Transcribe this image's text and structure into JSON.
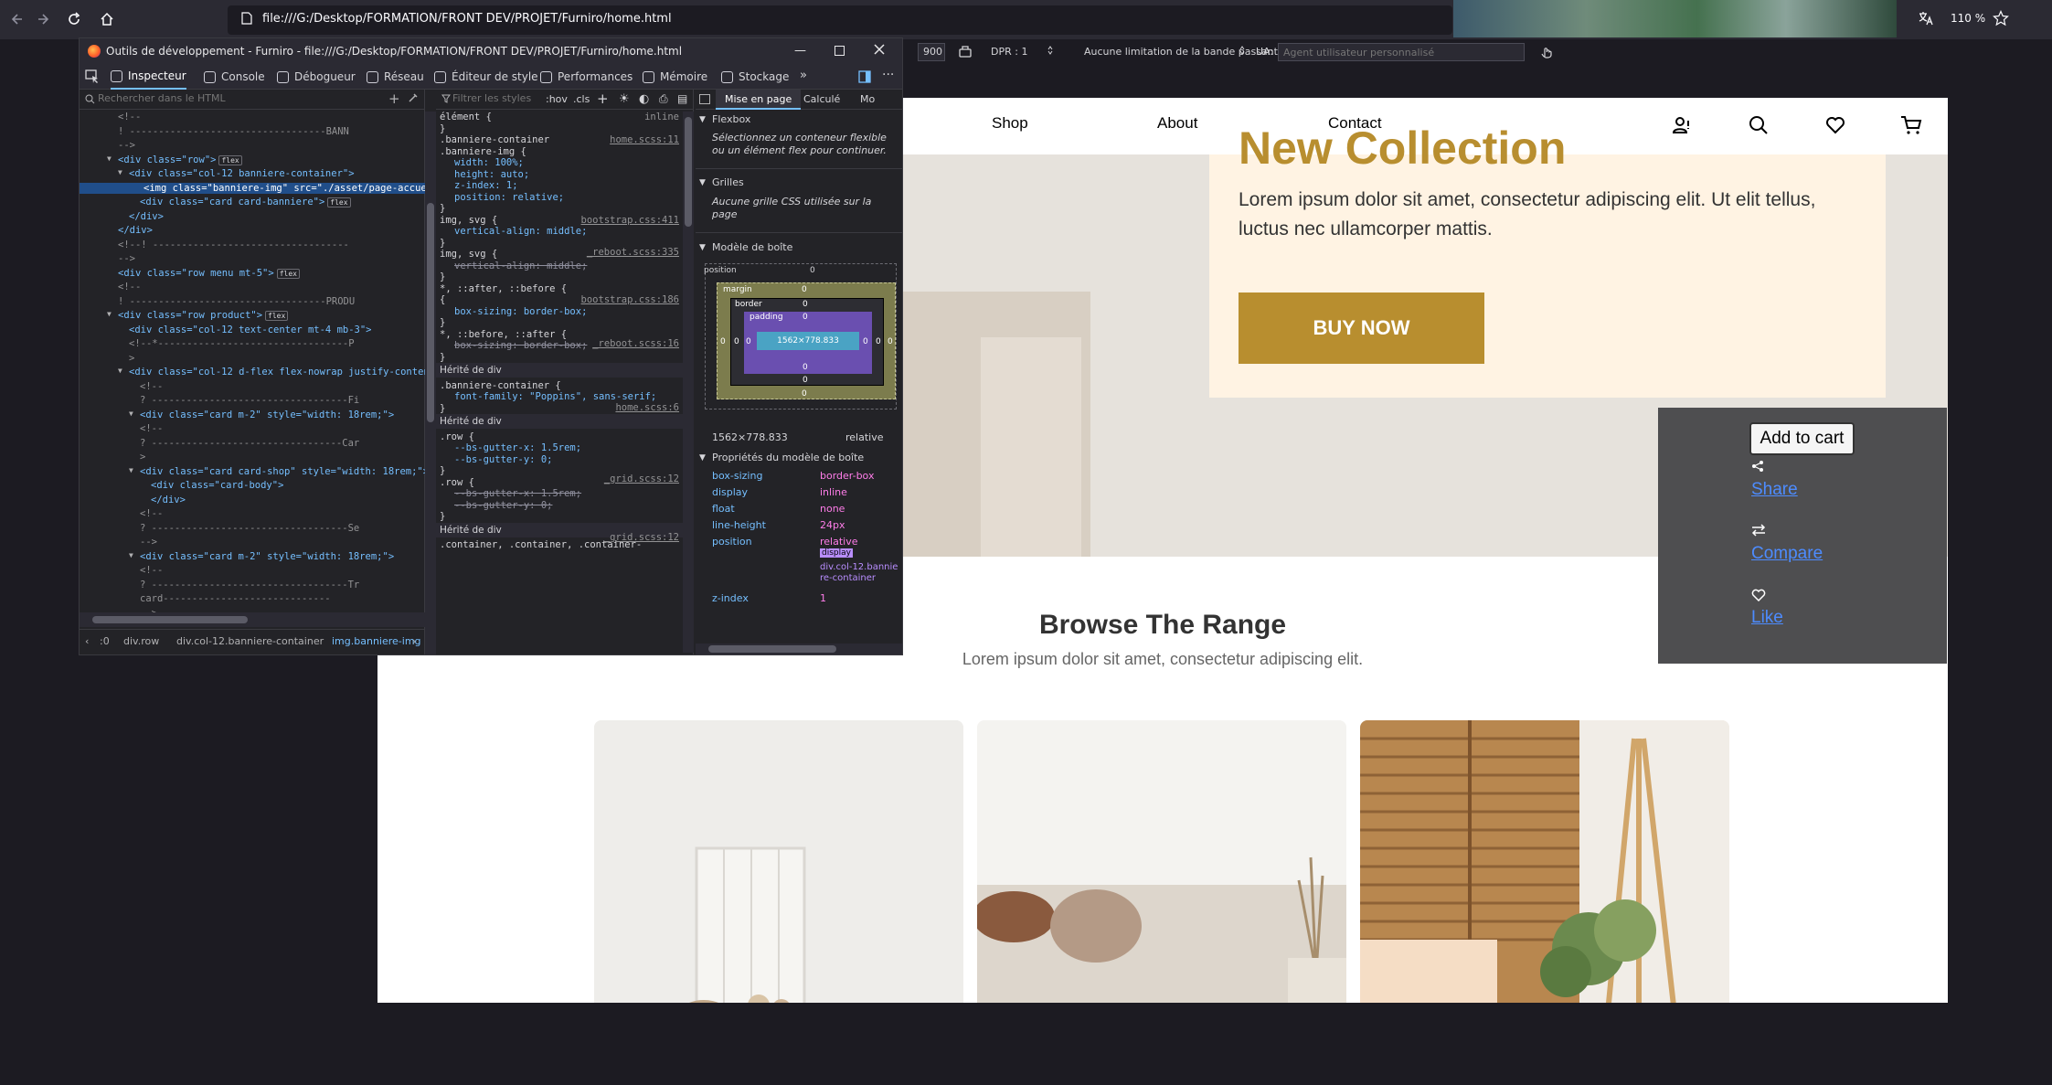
{
  "browser": {
    "url": "file:///G:/Desktop/FORMATION/FRONT DEV/PROJET/Furniro/home.html",
    "zoom": "110 %"
  },
  "responsive": {
    "height_value": "900",
    "dpr": "DPR : 1",
    "throttle": "Aucune limitation de la bande passante",
    "ua_label": "UA:",
    "ua_placeholder": "Agent utilisateur personnalisé"
  },
  "devtools": {
    "title": "Outils de développement - Furniro - file:///G:/Desktop/FORMATION/FRONT DEV/PROJET/Furniro/home.html",
    "tabs": [
      "Inspecteur",
      "Console",
      "Débogueur",
      "Réseau",
      "Éditeur de style",
      "Performances",
      "Mémoire",
      "Stockage"
    ],
    "search_placeholder": "Rechercher dans le HTML",
    "filter_placeholder": "Filtrer les styles",
    "hov": ":hov",
    "cls": ".cls",
    "layout_tabs": [
      "Mise en page",
      "Calculé",
      "Mo"
    ],
    "flexbox_title": "Flexbox",
    "flexbox_text": "Sélectionnez un conteneur flexible ou un élément flex pour continuer.",
    "grid_title": "Grilles",
    "grid_text": "Aucune grille CSS utilisée sur la page",
    "box_title": "Modèle de boîte",
    "box": {
      "position": "position",
      "margin": "margin",
      "border": "border",
      "padding": "padding",
      "content": "1562×778.833",
      "zero": "0"
    },
    "box_dims": "1562×778.833",
    "box_pos": "relative",
    "props_title": "Propriétés du modèle de boîte",
    "props": [
      {
        "k": "box-sizing",
        "v": "border-box"
      },
      {
        "k": "display",
        "v": "inline"
      },
      {
        "k": "float",
        "v": "none"
      },
      {
        "k": "line-height",
        "v": "24px"
      },
      {
        "k": "position",
        "v": "relative"
      }
    ],
    "offset_parent_badge": "display",
    "offset_parent_text": "div.col-12.banniere-container",
    "zindex_k": "z-index",
    "zindex_v": "1",
    "breadcrumb": [
      ":0",
      "div.row",
      "div.col-12.banniere-container",
      "img.banniere-img"
    ],
    "html_lines": [
      "<!--",
      "! ----------------------------------BANN",
      "-->",
      "<div class=\"row\">",
      "<div class=\"col-12 banniere-container\">",
      "<img class=\"banniere-img\" src=\"./asset/page-accuei",
      "<div class=\"card card-banniere\">",
      "</div>",
      "</div>",
      "<!--! ----------------------------------",
      "-->",
      "<div class=\"row menu mt-5\">",
      "<!--",
      "! ----------------------------------PRODU",
      "<div class=\"row product\">",
      "<div class=\"col-12 text-center mt-4 mb-3\">",
      "<!--*---------------------------------P",
      ">",
      "<div class=\"col-12 d-flex flex-nowrap justify-content",
      "<!--",
      "? ----------------------------------Fi",
      "<div class=\"card m-2\" style=\"width: 18rem;\">",
      "<!--",
      "? ---------------------------------Car",
      ">",
      "<div class=\"card card-shop\" style=\"width: 18rem;\">",
      "<div class=\"card-body\">",
      "</div>",
      "<!--",
      "? ----------------------------------Se",
      "-->",
      "<div class=\"card m-2\" style=\"width: 18rem;\">",
      "<!--",
      "? ----------------------------------Tr",
      "card-----------------------------",
      "-->"
    ],
    "css_lines": [
      "élément {",
      "}",
      ".banniere-container",
      ".banniere-img {",
      "width: 100%;",
      "height: auto;",
      "z-index: 1;",
      "position: relative;",
      "}",
      "img, svg {",
      "vertical-align: middle;",
      "}",
      "img, svg {",
      "vertical-align: middle;",
      "}",
      "*, ::after, ::before {",
      "{",
      "box-sizing: border-box;",
      "}",
      "*, ::before, ::after {",
      "box-sizing: border-box;",
      "}",
      "Hérité de div",
      ".banniere-container {",
      "font-family: \"Poppins\", sans-serif;",
      "}",
      "Hérité de div",
      ".row {",
      "--bs-gutter-x: 1.5rem;",
      "--bs-gutter-y: 0;",
      "}",
      ".row {",
      "--bs-gutter-x: 1.5rem;",
      "--bs-gutter-y: 0;",
      "}",
      "Hérité de div",
      ".container, .container, .container-"
    ],
    "css_sources": [
      "inline",
      "home.scss:11",
      "bootstrap.css:411",
      "_reboot.scss:335",
      "bootstrap.css:186",
      "_reboot.scss:16",
      "home.scss:6",
      "_grid.scss:12",
      "_grid.scss:12"
    ]
  },
  "site": {
    "nav": [
      "Shop",
      "About",
      "Contact"
    ],
    "hero_heading": "New Collection",
    "hero_text": "Lorem ipsum dolor sit amet, consectetur adipiscing elit. Ut elit tellus, luctus nec ullamcorper mattis.",
    "buy_now": "BUY NOW",
    "range_title": "Browse The Range",
    "range_sub": "Lorem ipsum dolor sit amet, consectetur adipiscing elit.",
    "overlay": {
      "add_to_cart": "Add to cart",
      "share": "Share",
      "compare": "Compare",
      "like": "Like"
    }
  },
  "colors": {
    "accent": "#b88e2f",
    "promo_bg": "#fff3e3",
    "devtools_select": "#204e8a"
  }
}
